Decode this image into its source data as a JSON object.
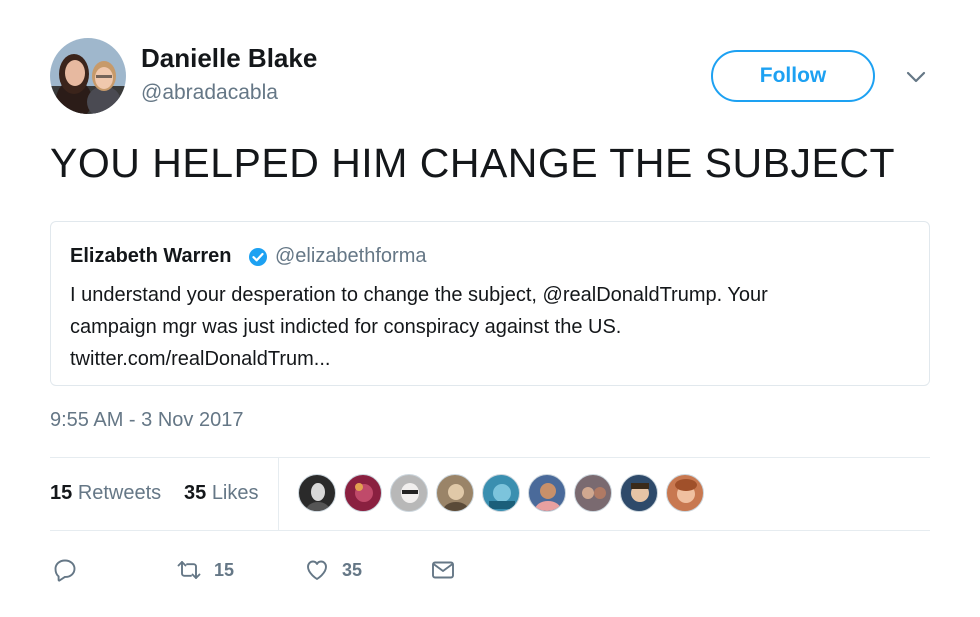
{
  "author": {
    "display_name": "Danielle Blake",
    "handle": "@abradacabla",
    "avatar_icon": "profile-photo"
  },
  "follow_button": {
    "label": "Follow"
  },
  "menu": {
    "icon": "chevron-down-icon"
  },
  "tweet": {
    "text": "YOU HELPED HIM CHANGE THE SUBJECT",
    "timestamp": "9:55 AM - 3 Nov 2017"
  },
  "quoted_tweet": {
    "author_name": "Elizabeth Warren",
    "verified": true,
    "handle": "@elizabethforma",
    "lines": [
      "I understand your desperation to change the subject, @realDonaldTrump. Your",
      "campaign mgr was just indicted for conspiracy against the US.",
      "twitter.com/realDonaldTrum..."
    ]
  },
  "stats": {
    "retweets_count": "15",
    "retweets_label": "Retweets",
    "likes_count": "35",
    "likes_label": "Likes",
    "liker_avatars": 9
  },
  "actions": {
    "reply_icon": "reply-icon",
    "retweet_icon": "retweet-icon",
    "retweet_count": "15",
    "like_icon": "heart-icon",
    "like_count": "35",
    "dm_icon": "envelope-icon"
  },
  "colors": {
    "accent": "#1da1f2",
    "secondary_text": "#657786",
    "primary_text": "#14171a",
    "border": "#e1e8ed"
  }
}
